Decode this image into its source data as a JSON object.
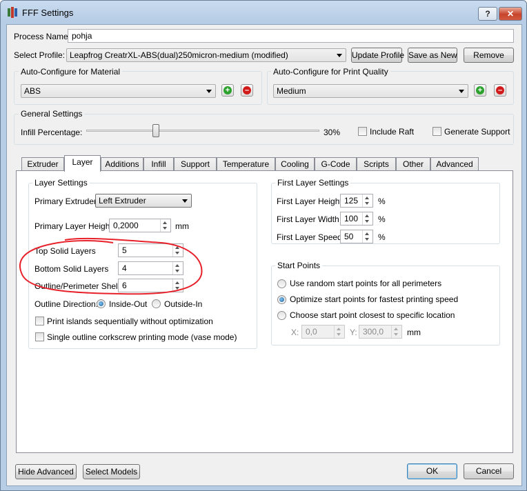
{
  "window": {
    "title": "FFF Settings",
    "help_label": "?",
    "close_label": "✕"
  },
  "process": {
    "name_label": "Process Name:",
    "name_value": "pohja"
  },
  "profile": {
    "label": "Select Profile:",
    "selected": "Leapfrog CreatrXL-ABS(dual)250micron-medium (modified)",
    "update_label": "Update Profile",
    "save_as_new_label": "Save as New",
    "remove_label": "Remove"
  },
  "auto_material": {
    "title": "Auto-Configure for Material",
    "selected": "ABS",
    "add": "+",
    "remove": "–"
  },
  "auto_quality": {
    "title": "Auto-Configure for Print Quality",
    "selected": "Medium",
    "add": "+",
    "remove": "–"
  },
  "general": {
    "title": "General Settings",
    "infill_label": "Infill Percentage:",
    "infill_value": "30%",
    "infill_fraction": 0.3,
    "include_raft": "Include Raft",
    "generate_support": "Generate Support"
  },
  "tabs": [
    "Extruder",
    "Layer",
    "Additions",
    "Infill",
    "Support",
    "Temperature",
    "Cooling",
    "G-Code",
    "Scripts",
    "Other",
    "Advanced"
  ],
  "active_tab": "Layer",
  "layer_settings": {
    "title": "Layer Settings",
    "primary_extruder_label": "Primary Extruder",
    "primary_extruder_value": "Left Extruder",
    "primary_height_label": "Primary Layer Height",
    "primary_height_value": "0,2000",
    "primary_height_unit": "mm",
    "top_solid_label": "Top Solid Layers",
    "top_solid_value": "5",
    "bottom_solid_label": "Bottom Solid Layers",
    "bottom_solid_value": "4",
    "outline_shells_label": "Outline/Perimeter Shells",
    "outline_shells_value": "6",
    "outline_direction_label": "Outline Direction:",
    "inside_out": "Inside-Out",
    "outside_in": "Outside-In",
    "print_islands": "Print islands sequentially without optimization",
    "corkscrew": "Single outline corkscrew printing mode (vase mode)"
  },
  "first_layer": {
    "title": "First Layer Settings",
    "height_label": "First Layer Height",
    "height_value": "125",
    "width_label": "First Layer Width",
    "width_value": "100",
    "speed_label": "First Layer Speed",
    "speed_value": "50",
    "unit": "%"
  },
  "start_points": {
    "title": "Start Points",
    "random": "Use random start points for all perimeters",
    "optimize": "Optimize start points for fastest printing speed",
    "closest": "Choose start point closest to specific location",
    "x_label": "X:",
    "x_value": "0,0",
    "y_label": "Y:",
    "y_value": "300,0",
    "unit": "mm"
  },
  "footer": {
    "hide_advanced": "Hide Advanced",
    "select_models": "Select Models",
    "ok": "OK",
    "cancel": "Cancel"
  },
  "colors": {
    "annotation": "#e8202a",
    "window_frame": "#b7cde6"
  }
}
